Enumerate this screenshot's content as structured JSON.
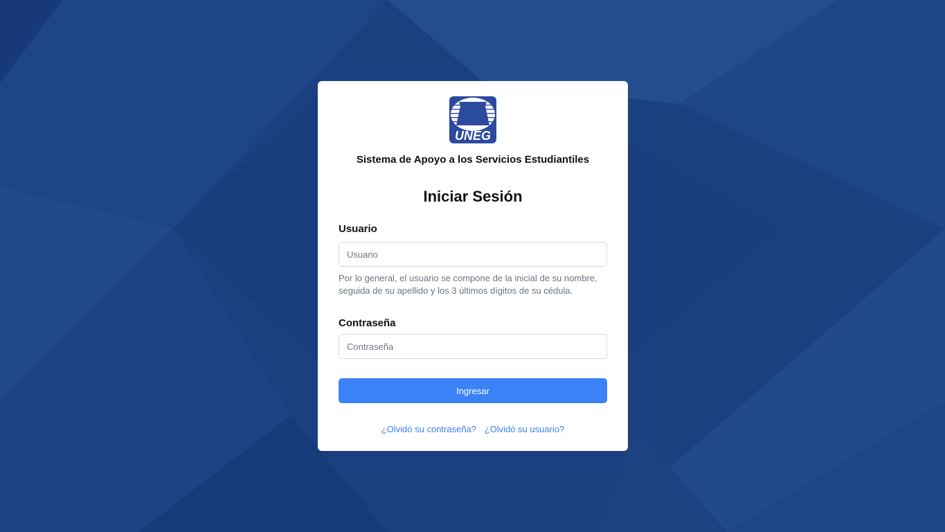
{
  "brand": {
    "logo_text": "UNEG",
    "logo_color": "#2c4a9e",
    "system_name": "Sistema de Apoyo a los Servicios Estudiantiles"
  },
  "login": {
    "title": "Iniciar Sesión",
    "username": {
      "label": "Usuario",
      "placeholder": "Usuario",
      "value": "",
      "help": "Por lo general, el usuario se compone de la inicial de su nombre, seguida de su apellido y los 3 últimos dígitos de su cédula."
    },
    "password": {
      "label": "Contraseña",
      "placeholder": "Contraseña",
      "value": ""
    },
    "submit_label": "Ingresar",
    "forgot_password": "¿Olvidó su contraseña?",
    "forgot_username": "¿Olvidó su usuario?"
  },
  "colors": {
    "background": "#1a3f7e",
    "primary": "#3b82f6",
    "card": "#ffffff"
  }
}
